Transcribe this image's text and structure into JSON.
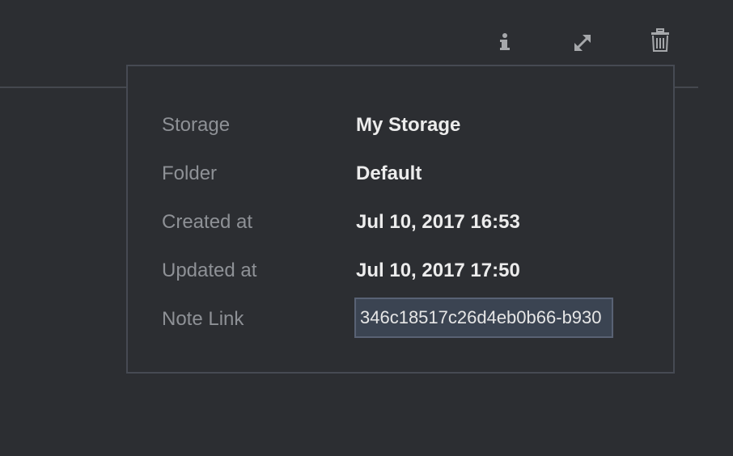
{
  "toolbar": {
    "icons": [
      "info-icon",
      "expand-icon",
      "trash-icon"
    ],
    "icon_color": "#a6a8ab"
  },
  "info_panel": {
    "rows": [
      {
        "label": "Storage",
        "value": "My Storage"
      },
      {
        "label": "Folder",
        "value": "Default"
      },
      {
        "label": "Created at",
        "value": "Jul 10, 2017 16:53"
      },
      {
        "label": "Updated at",
        "value": "Jul 10, 2017 17:50"
      }
    ],
    "note_link": {
      "label": "Note Link",
      "value": "346c18517c26d4eb0b66-b930"
    }
  },
  "colors": {
    "background": "#2c2e32",
    "border": "#464a53",
    "label": "#8e9196",
    "value": "#ececec",
    "link_field_bg": "#3b4452"
  }
}
